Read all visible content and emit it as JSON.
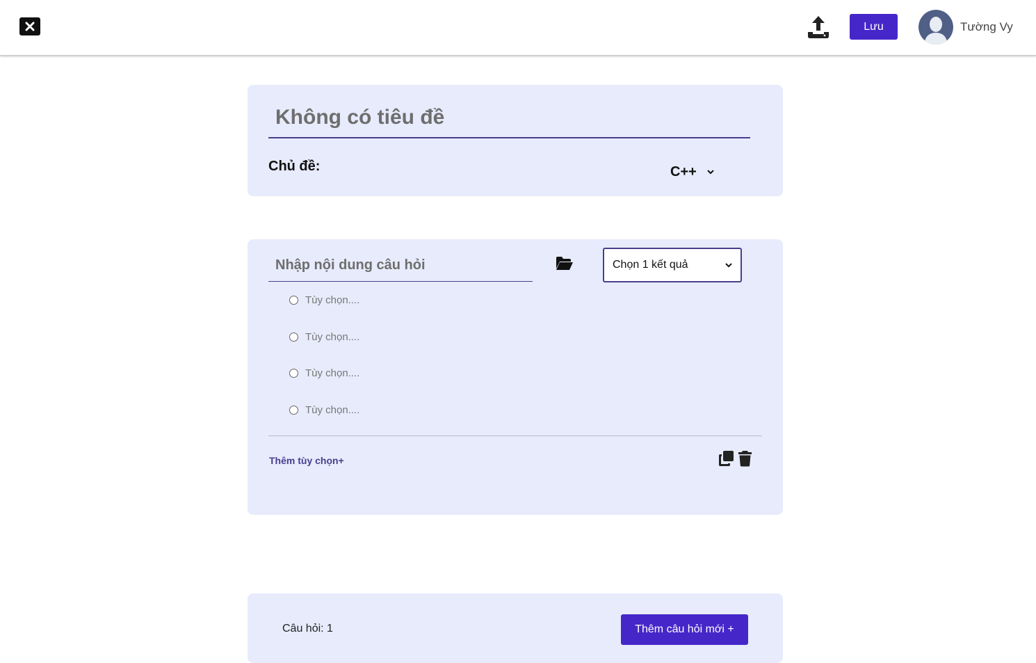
{
  "header": {
    "save_label": "Lưu",
    "username": "Tường Vy",
    "accent_color": "#4527c9"
  },
  "quiz": {
    "title_placeholder": "Không có tiêu đề",
    "topic_label": "Chủ đề:",
    "topic_value": "C++"
  },
  "question": {
    "content_placeholder": "Nhập nội dung câu hỏi",
    "answer_type": "Chọn 1 kết quả",
    "options": [
      "Tùy chọn....",
      "Tùy chọn....",
      "Tùy chọn....",
      "Tùy chọn...."
    ],
    "add_option_label": "Thêm tùy chọn+"
  },
  "footer": {
    "count_label": "Câu hỏi: 1",
    "add_question_label": "Thêm câu hỏi mới +"
  },
  "icons": [
    "close-icon",
    "upload-icon",
    "avatar-icon",
    "chevron-down-icon",
    "folder-open-icon",
    "copy-icon",
    "trash-icon"
  ]
}
